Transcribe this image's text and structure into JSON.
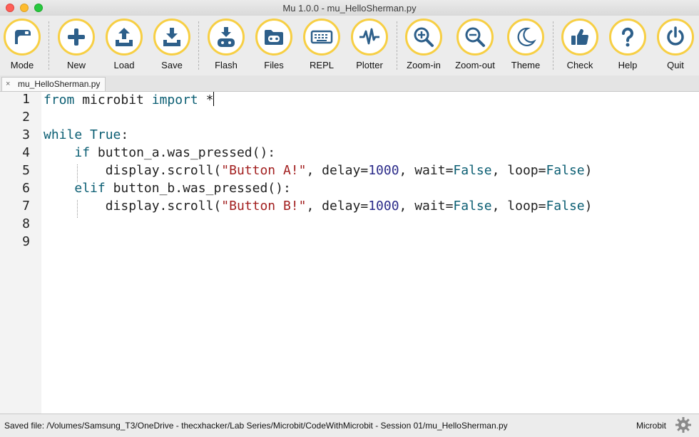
{
  "window": {
    "title": "Mu 1.0.0 - mu_HelloSherman.py"
  },
  "colors": {
    "accent_ring": "#f7cf44",
    "icon_blue": "#2d5f8a",
    "close": "#fe5f57",
    "minimize": "#febc2e",
    "zoom": "#28c840"
  },
  "toolbar": {
    "mode": "Mode",
    "new": "New",
    "load": "Load",
    "save": "Save",
    "flash": "Flash",
    "files": "Files",
    "repl": "REPL",
    "plotter": "Plotter",
    "zoom_in": "Zoom-in",
    "zoom_out": "Zoom-out",
    "theme": "Theme",
    "check": "Check",
    "help": "Help",
    "quit": "Quit"
  },
  "tab": {
    "name": "mu_HelloSherman.py",
    "close": "×"
  },
  "editor": {
    "line_numbers": [
      "1",
      "2",
      "3",
      "4",
      "5",
      "6",
      "7",
      "8",
      "9"
    ],
    "lines": [
      {
        "indent": "",
        "parts": [
          [
            "kw",
            "from"
          ],
          [
            "",
            "microbit"
          ],
          [
            "kw",
            "import"
          ],
          [
            "",
            "*"
          ]
        ]
      },
      {
        "indent": "",
        "parts": []
      },
      {
        "indent": "",
        "parts": [
          [
            "kw",
            "while"
          ],
          [
            "kwa",
            "True"
          ],
          [
            "",
            ":"
          ]
        ]
      },
      {
        "indent": "    ",
        "parts": [
          [
            "kw",
            "if"
          ],
          [
            "",
            "button_a.was_pressed():"
          ]
        ]
      },
      {
        "indent": "        ",
        "parts": [
          [
            "",
            "display.scroll("
          ],
          [
            "str",
            "\"Button A!\""
          ],
          [
            "",
            ", delay="
          ],
          [
            "num",
            "1000"
          ],
          [
            "",
            ", wait="
          ],
          [
            "kwa",
            "False"
          ],
          [
            "",
            ", loop="
          ],
          [
            "kwa",
            "False"
          ],
          [
            "",
            ")"
          ]
        ]
      },
      {
        "indent": "    ",
        "parts": [
          [
            "kw",
            "elif"
          ],
          [
            "",
            "button_b.was_pressed():"
          ]
        ]
      },
      {
        "indent": "        ",
        "parts": [
          [
            "",
            "display.scroll("
          ],
          [
            "str",
            "\"Button B!\""
          ],
          [
            "",
            ", delay="
          ],
          [
            "num",
            "1000"
          ],
          [
            "",
            ", wait="
          ],
          [
            "kwa",
            "False"
          ],
          [
            "",
            ", loop="
          ],
          [
            "kwa",
            "False"
          ],
          [
            "",
            ")"
          ]
        ]
      },
      {
        "indent": "",
        "parts": []
      },
      {
        "indent": "",
        "parts": []
      }
    ]
  },
  "status": {
    "message": "Saved file: /Volumes/Samsung_T3/OneDrive - thecxhacker/Lab Series/Microbit/CodeWithMicrobit - Session 01/mu_HelloSherman.py",
    "mode": "Microbit",
    "settings_icon": "gear-icon"
  }
}
